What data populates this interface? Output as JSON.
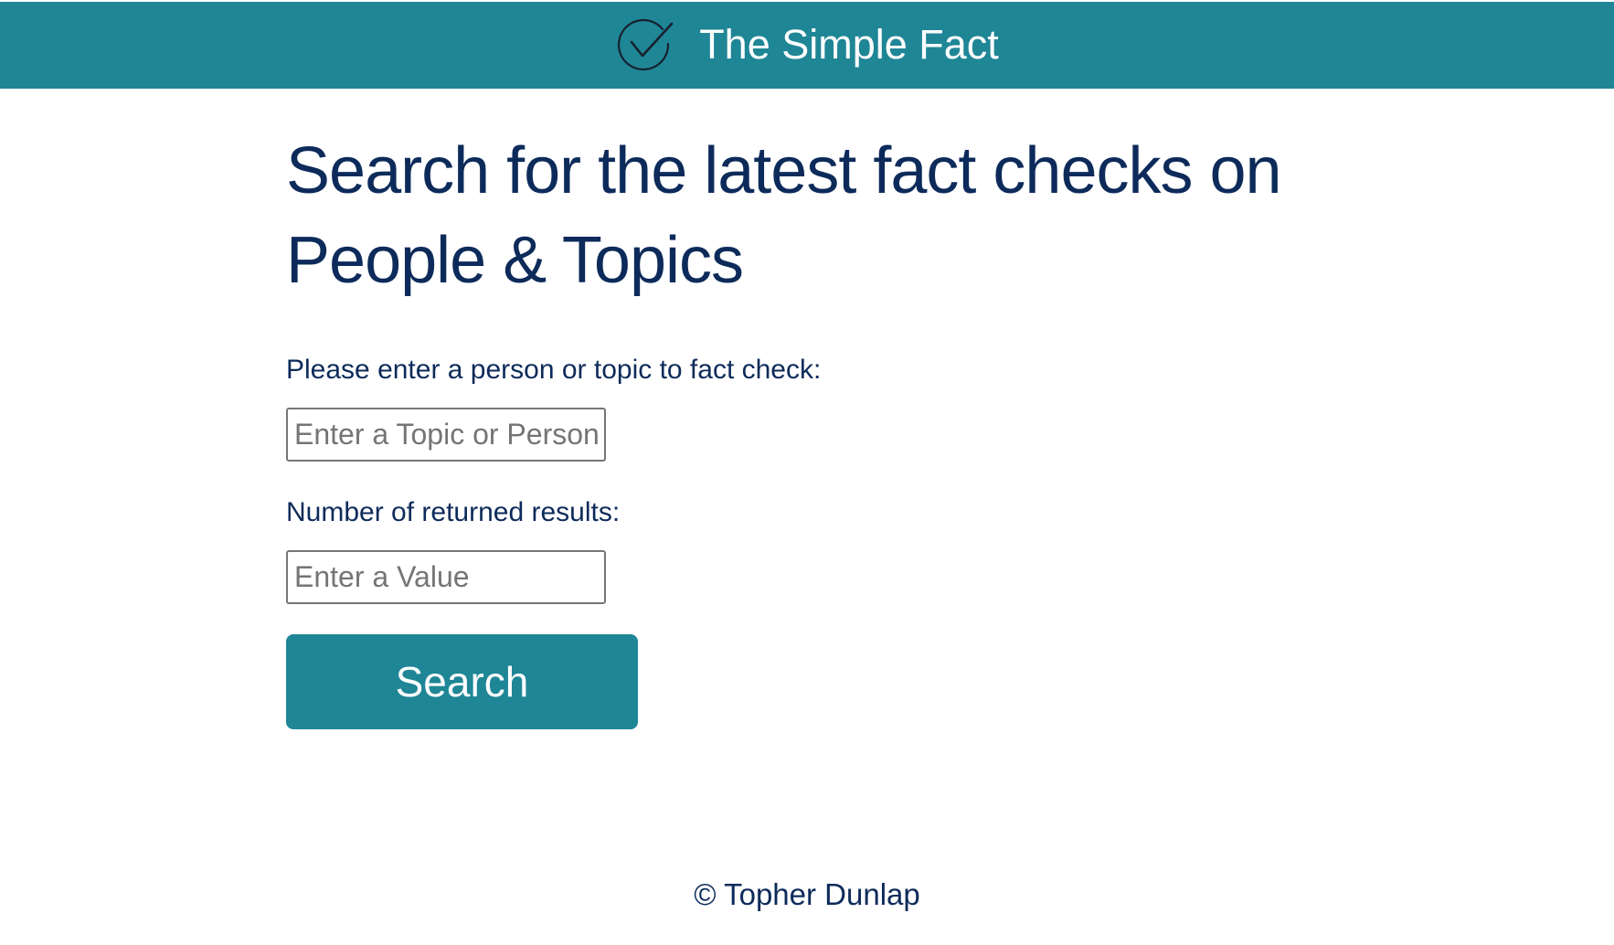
{
  "header": {
    "title": "The Simple Fact",
    "icon": "check-circle-icon",
    "background_color": "#1f8696"
  },
  "main": {
    "heading": "Search for the latest fact checks on People & Topics",
    "topic_label": "Please enter a person or topic to fact check:",
    "topic_placeholder": "Enter a Topic or Person",
    "topic_value": "",
    "results_label": "Number of returned results:",
    "results_placeholder": "Enter a Value",
    "results_value": "",
    "search_label": "Search",
    "accent_color": "#1f8696",
    "text_color": "#0d2b5a"
  },
  "footer": {
    "text": "© Topher Dunlap"
  }
}
